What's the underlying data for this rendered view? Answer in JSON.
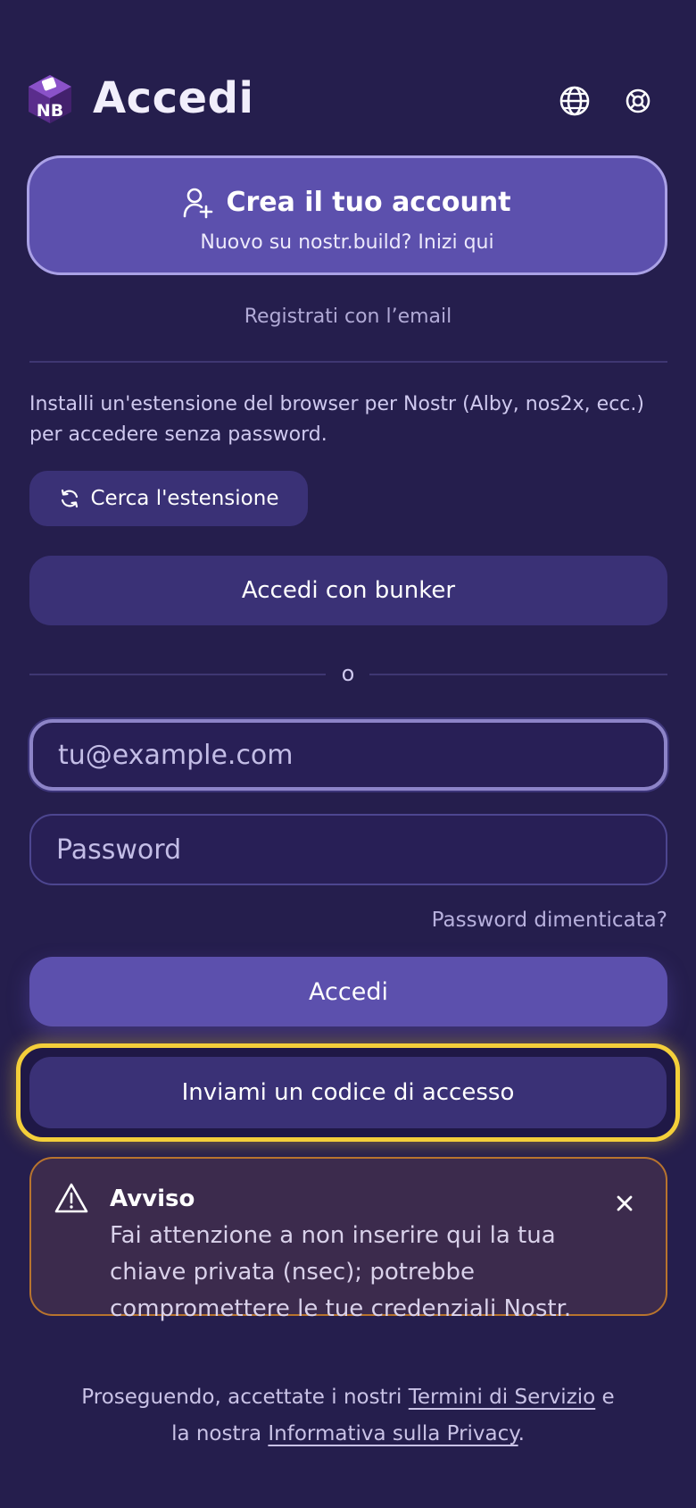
{
  "header": {
    "logo_text": "NB",
    "title": "Accedi",
    "language_icon": "globe-icon",
    "support_icon": "lifebuoy-icon"
  },
  "create_account": {
    "title": "Crea il tuo account",
    "subtitle": "Nuovo su nostr.build? Inizi qui",
    "icon": "user-plus-icon"
  },
  "register_email": "Registrati con l’email",
  "extension": {
    "info": "Installi un'estensione del browser per Nostr (Alby, nos2x, ecc.) per accedere senza password.",
    "search_label": "Cerca l'estensione",
    "search_icon": "refresh-icon"
  },
  "bunker_label": "Accedi con bunker",
  "separator_text": "o",
  "form": {
    "email_placeholder": "tu@example.com",
    "email_value": "",
    "password_placeholder": "Password",
    "password_value": "",
    "forgot_label": "Password dimenticata?",
    "login_label": "Accedi",
    "code_label": "Inviami un codice di accesso"
  },
  "warning": {
    "title": "Avviso",
    "body": "Fai attenzione a non inserire qui la tua chiave privata (nsec); potrebbe compromettere le tue credenziali Nostr.",
    "icon": "warning-triangle-icon",
    "close_icon": "close-icon"
  },
  "footer": {
    "prefix": "Proseguendo, accettate i nostri ",
    "terms_link": "Termini di Servizio",
    "middle": " e la nostra ",
    "privacy_link": "Informativa sulla Privacy",
    "suffix": "."
  },
  "colors": {
    "background": "#251e4d",
    "primary": "#5c50ad",
    "secondary_button": "#3a3176",
    "highlight": "#f4cf3a",
    "warning_border": "#b8742e"
  }
}
